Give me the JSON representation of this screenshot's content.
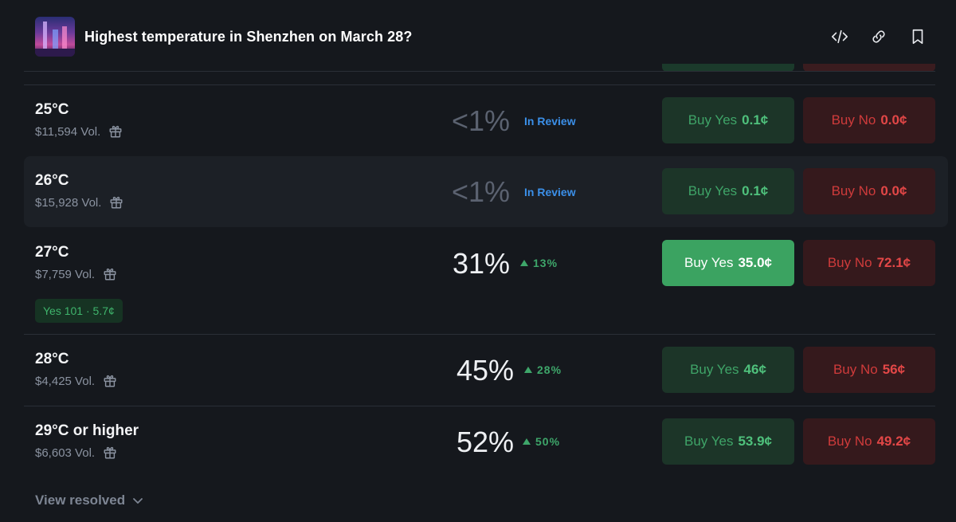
{
  "header": {
    "title": "Highest temperature in Shenzhen on March 28?",
    "icons": [
      "code-icon",
      "link-icon",
      "bookmark-icon"
    ]
  },
  "rows": [
    {
      "label": "25°C",
      "volume": "$11,594 Vol.",
      "percent": "<1%",
      "status": "In Review",
      "yes_label": "Buy Yes",
      "yes_price": "0.1¢",
      "no_label": "Buy No",
      "no_price": "0.0¢"
    },
    {
      "label": "26°C",
      "volume": "$15,928 Vol.",
      "percent": "<1%",
      "status": "In Review",
      "yes_label": "Buy Yes",
      "yes_price": "0.1¢",
      "no_label": "Buy No",
      "no_price": "0.0¢"
    },
    {
      "label": "27°C",
      "volume": "$7,759 Vol.",
      "percent": "31%",
      "change": "13%",
      "yes_label": "Buy Yes",
      "yes_price": "35.0¢",
      "no_label": "Buy No",
      "no_price": "72.1¢",
      "position": "Yes 101 · 5.7¢"
    },
    {
      "label": "28°C",
      "volume": "$4,425 Vol.",
      "percent": "45%",
      "change": "28%",
      "yes_label": "Buy Yes",
      "yes_price": "46¢",
      "no_label": "Buy No",
      "no_price": "56¢"
    },
    {
      "label": "29°C or higher",
      "volume": "$6,603 Vol.",
      "percent": "52%",
      "change": "50%",
      "yes_label": "Buy Yes",
      "yes_price": "53.9¢",
      "no_label": "Buy No",
      "no_price": "49.2¢"
    }
  ],
  "footer": {
    "view_resolved": "View resolved"
  },
  "colors": {
    "background": "#15181d",
    "yes": "#3ba361",
    "no": "#e34747",
    "review": "#3b8fe8"
  }
}
